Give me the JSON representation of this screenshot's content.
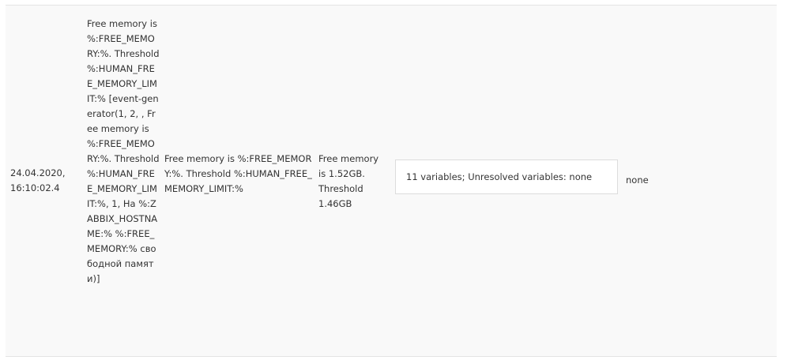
{
  "row": {
    "time": "24.04.2020, 16:10:02.4",
    "mask": "Free memory is %:FREE_MEMORY:%. Threshold %:HUMAN_FREE_MEMORY_LIMIT:% [event-generator(1, 2, , Free memory is %:FREE_MEMORY:%. Threshold %:HUMAN_FREE_MEMORY_LIMIT:%, 1, На %:ZABBIX_HOSTNAME:% %:FREE_MEMORY:% свободной памяти)]",
    "resolved_text": "Free memory is %:FREE_MEMORY:%. Threshold %:HUMAN_FREE_MEMORY_LIMIT:%",
    "result": "Free memory is 1.52GB. Threshold 1.46GB",
    "variables": "11 variables; Unresolved variables: none",
    "unresolved": "none"
  }
}
